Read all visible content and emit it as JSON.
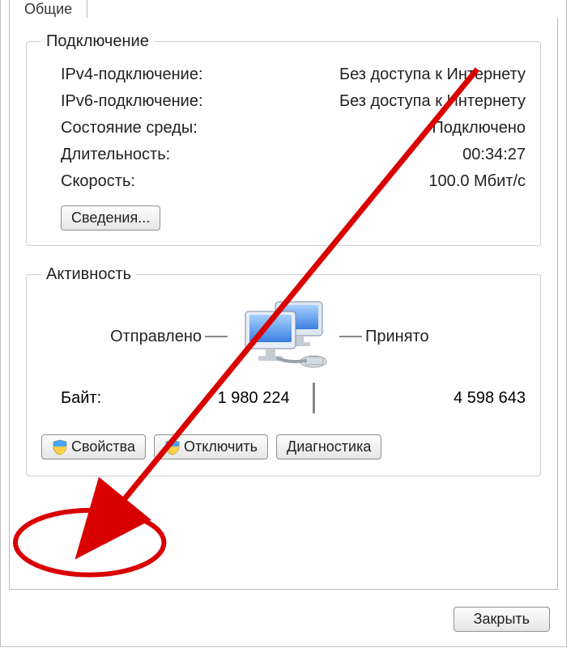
{
  "tab": {
    "label": "Общие"
  },
  "connection": {
    "legend": "Подключение",
    "rows": [
      {
        "label": "IPv4-подключение:",
        "value": "Без доступа к Интернету"
      },
      {
        "label": "IPv6-подключение:",
        "value": "Без доступа к Интернету"
      },
      {
        "label": "Состояние среды:",
        "value": "Подключено"
      },
      {
        "label": "Длительность:",
        "value": "00:34:27"
      },
      {
        "label": "Скорость:",
        "value": "100.0 Мбит/с"
      }
    ],
    "details_button": "Сведения..."
  },
  "activity": {
    "legend": "Активность",
    "sent_label": "Отправлено",
    "received_label": "Принято",
    "bytes_label": "Байт:",
    "bytes_sent": "1 980 224",
    "bytes_received": "4 598 643"
  },
  "buttons": {
    "properties": "Свойства",
    "disable": "Отключить",
    "diagnose": "Диагностика",
    "close": "Закрыть"
  }
}
